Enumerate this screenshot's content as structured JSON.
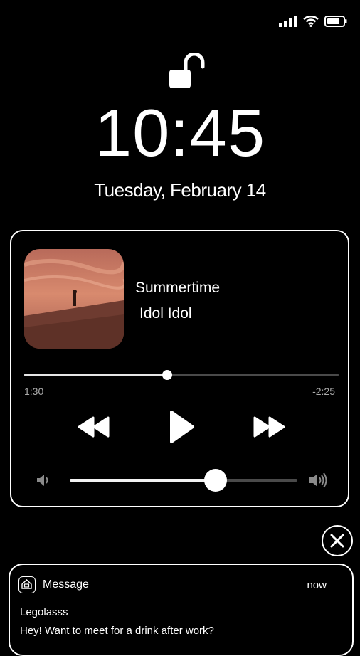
{
  "status_bar": {
    "icons": [
      "signal-icon",
      "wifi-icon",
      "battery-icon"
    ]
  },
  "lock_screen": {
    "time": "10:45",
    "date": "Tuesday, February 14"
  },
  "now_playing": {
    "title": "Summertime",
    "artist": "Idol Idol",
    "elapsed": "1:30",
    "remaining": "-2:25",
    "progress_fraction": 0.455,
    "volume_fraction": 0.64
  },
  "notification": {
    "app_name": "Message",
    "time": "now",
    "sender": "Legolasss",
    "body": "Hey! Want to meet for a drink after work?"
  }
}
